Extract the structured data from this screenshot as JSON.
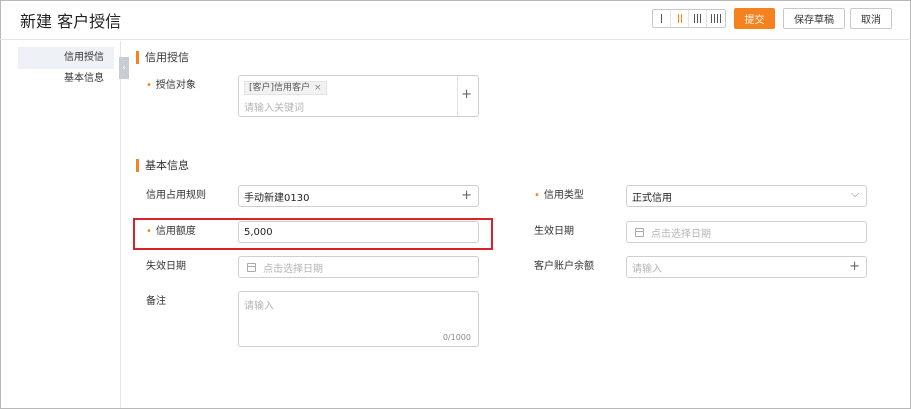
{
  "header": {
    "title": "新建 客户授信",
    "submit": "提交",
    "save_draft": "保存草稿",
    "cancel": "取消"
  },
  "layout_options": [
    "single-column",
    "two-column",
    "three-column",
    "four-column"
  ],
  "layout_active": "two-column",
  "nav": {
    "items": [
      {
        "label": "信用授信",
        "active": true
      },
      {
        "label": "基本信息",
        "active": false
      }
    ]
  },
  "sections": {
    "credit": "信用授信",
    "basic": "基本信息"
  },
  "credit_object": {
    "label": "授信对象",
    "tag": "[客户]信用客户",
    "tag_close": "×",
    "placeholder": "请输入关键词"
  },
  "fields": {
    "rule": {
      "label": "信用占用规则",
      "value": "手动新建0130"
    },
    "credit_type": {
      "label": "信用类型",
      "value": "正式信用"
    },
    "credit_limit": {
      "label": "信用额度",
      "value": "5,000"
    },
    "effective_date": {
      "label": "生效日期",
      "placeholder": "点击选择日期"
    },
    "expiry_date": {
      "label": "失效日期",
      "placeholder": "点击选择日期"
    },
    "balance": {
      "label": "客户账户余额",
      "placeholder": "请输入"
    },
    "remark": {
      "label": "备注",
      "placeholder": "请输入",
      "counter": "0/1000"
    }
  },
  "icons": {
    "plus": "+",
    "chevron": "⌵",
    "collapse": "‹"
  },
  "colors": {
    "accent": "#f5821f",
    "highlight": "#d8232a"
  }
}
